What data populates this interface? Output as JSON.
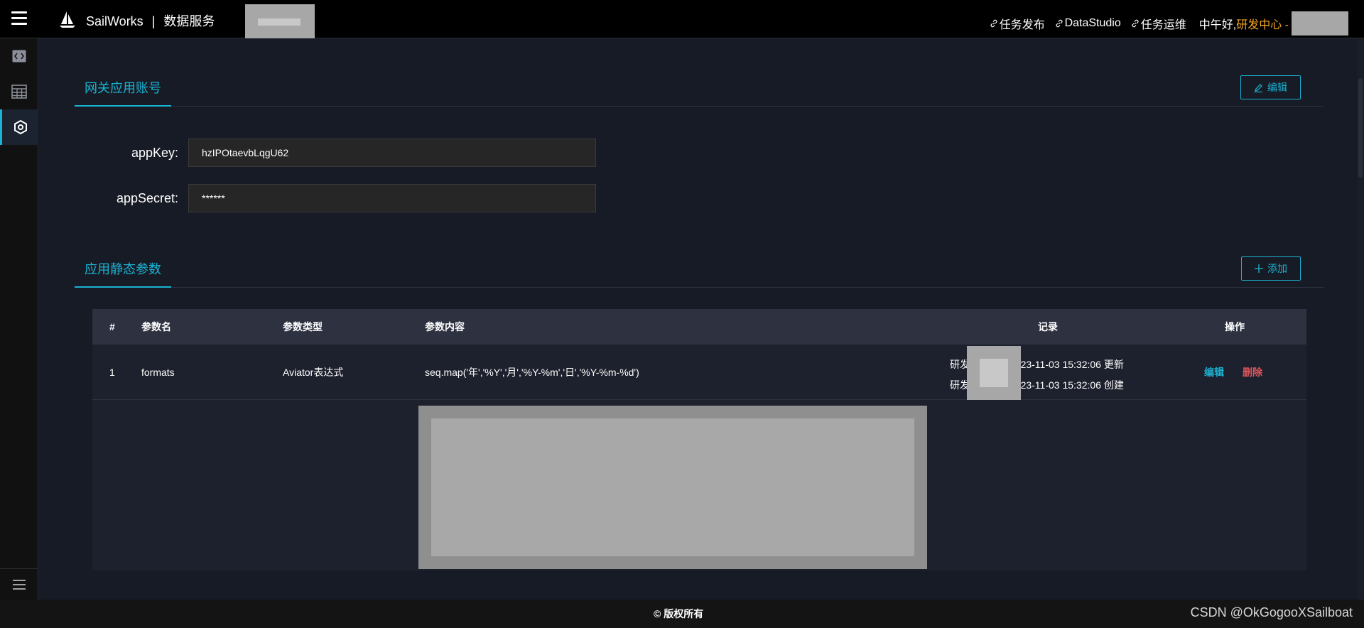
{
  "header": {
    "brand": "SailWorks",
    "separator": "|",
    "service": "数据服务",
    "links": [
      "任务发布",
      "DataStudio",
      "任务运维"
    ],
    "greeting": "中午好,",
    "department": "研发中心 -"
  },
  "gateway": {
    "title": "网关应用账号",
    "edit_label": "编辑",
    "app_key_label": "appKey:",
    "app_key_value": "hzIPOtaevbLqgU62",
    "app_secret_label": "appSecret:",
    "app_secret_value": "******"
  },
  "params": {
    "title": "应用静态参数",
    "add_label": "添加",
    "columns": [
      "#",
      "参数名",
      "参数类型",
      "参数内容",
      "记录",
      "操作"
    ],
    "rows": [
      {
        "index": "1",
        "name": "formats",
        "type": "Aviator表达式",
        "content": "seq.map('年','%Y','月','%Y-%m','日','%Y-%m-%d')",
        "record_prefix": "研发",
        "record_updated": "2023-11-03 15:32:06 更新",
        "record_created": "2023-11-03 15:32:06 创建",
        "edit": "编辑",
        "delete": "删除"
      }
    ]
  },
  "footer": {
    "copyright": "© 版权所有",
    "watermark": "CSDN @OkGogooXSailboat"
  },
  "colors": {
    "accent": "#1bb3d3",
    "warning": "#f5a623",
    "danger": "#e0555a"
  }
}
